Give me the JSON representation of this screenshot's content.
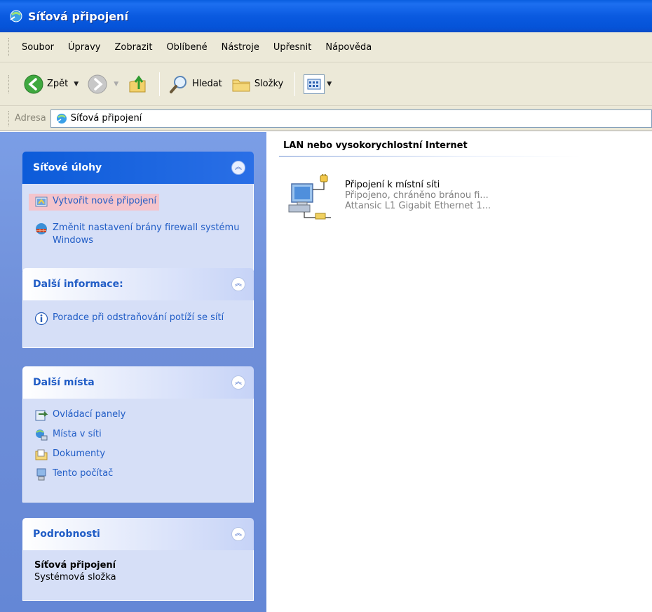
{
  "window": {
    "title": "Síťová připojení"
  },
  "menu": [
    "Soubor",
    "Úpravy",
    "Zobrazit",
    "Oblíbené",
    "Nástroje",
    "Upřesnit",
    "Nápověda"
  ],
  "toolbar": {
    "back_label": "Zpět",
    "search_label": "Hledat",
    "folders_label": "Složky"
  },
  "address": {
    "label": "Adresa",
    "value": "Síťová připojení"
  },
  "taskpane": {
    "network_tasks": {
      "title": "Síťové úlohy",
      "items": [
        "Vytvořit nové připojení",
        "Změnit nastavení brány firewall systému Windows"
      ]
    },
    "more_info": {
      "title": "Další informace:",
      "items": [
        "Poradce při odstraňování potíží se sítí"
      ]
    },
    "other_places": {
      "title": "Další místa",
      "items": [
        "Ovládací panely",
        "Místa v síti",
        "Dokumenty",
        "Tento počítač"
      ]
    },
    "details": {
      "title": "Podrobnosti",
      "name": "Síťová připojení",
      "type": "Systémová složka"
    }
  },
  "content": {
    "section_title": "LAN nebo vysokorychlostní Internet",
    "connection": {
      "name": "Připojení k místní síti",
      "status": "Připojeno, chráněno bránou fi...",
      "device": "Attansic L1 Gigabit Ethernet 1..."
    }
  }
}
